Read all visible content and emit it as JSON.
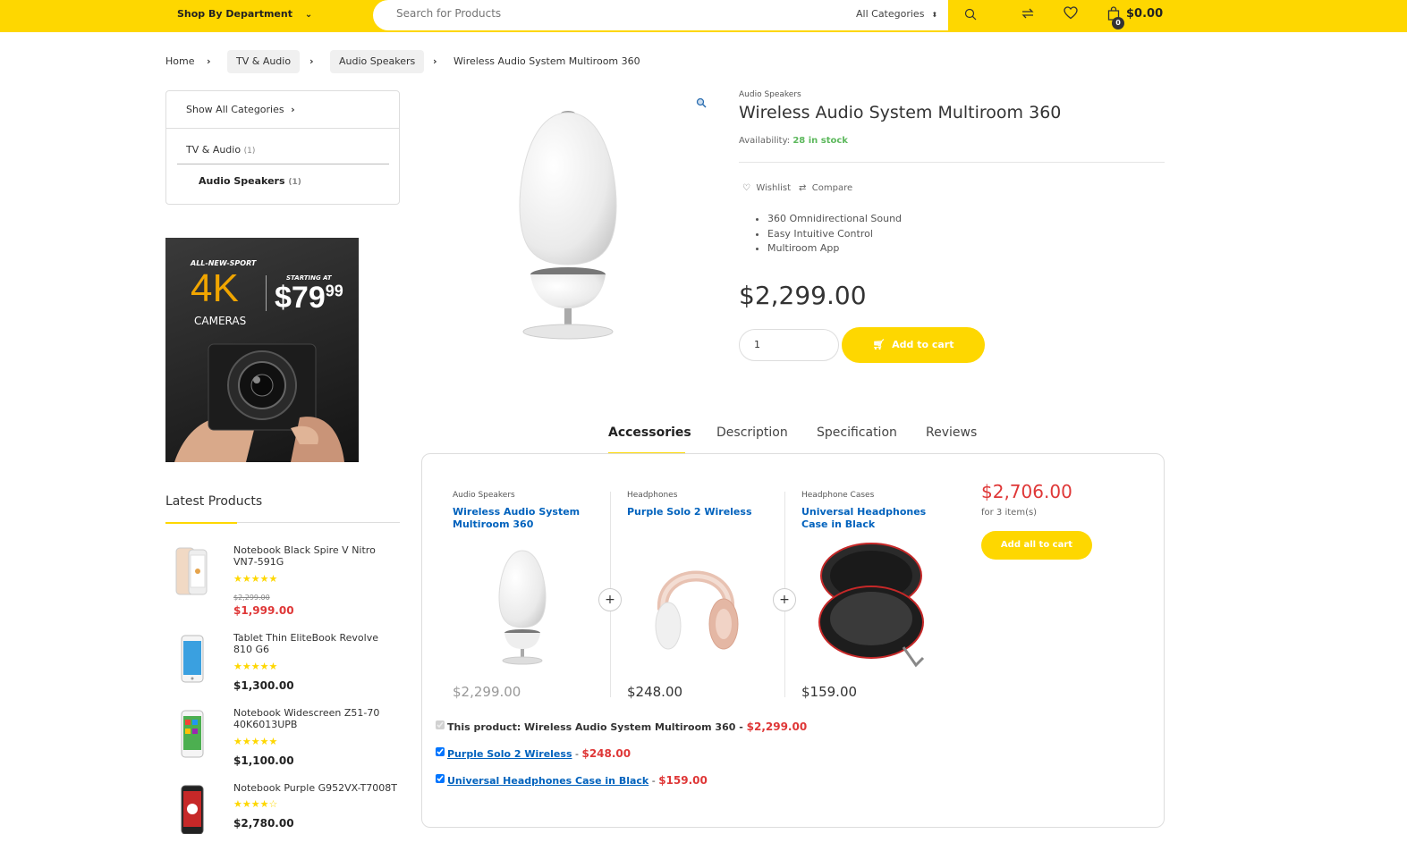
{
  "header": {
    "department_label": "Shop By Department",
    "search_placeholder": "Search for Products",
    "category_select": "All Categories",
    "cart_count": "0",
    "cart_total": "$0.00",
    "accent_color": "#fed700"
  },
  "breadcrumb": {
    "home": "Home",
    "level1": "TV & Audio",
    "level2": "Audio Speakers",
    "current": "Wireless Audio System Multiroom 360"
  },
  "sidebar": {
    "show_all": "Show All Categories",
    "tv_audio": "TV & Audio",
    "tv_audio_count": "(1)",
    "audio_speakers": "Audio Speakers",
    "audio_speakers_count": "(1)"
  },
  "banner": {
    "line1": "ALL-NEW-SPORT",
    "big": "4K",
    "line3": "CAMERAS",
    "starting": "STARTING AT",
    "price": "$79",
    "cents": "99"
  },
  "latest": {
    "title": "Latest Products",
    "items": [
      {
        "name": "Notebook Black Spire V Nitro VN7-591G",
        "stars": "★★★★★",
        "old_price": "$2,299.00",
        "price": "$1,999.00"
      },
      {
        "name": "Tablet Thin EliteBook Revolve 810 G6",
        "stars": "★★★★★",
        "price": "$1,300.00"
      },
      {
        "name": "Notebook Widescreen Z51-70 40K6013UPB",
        "stars": "★★★★★",
        "price": "$1,100.00"
      },
      {
        "name": "Notebook Purple G952VX-T7008T",
        "stars": "★★★★☆",
        "price": "$2,780.00"
      }
    ]
  },
  "product": {
    "category": "Audio Speakers",
    "title": "Wireless Audio System Multiroom 360",
    "availability_label": "Availability:",
    "availability_value": "28 in stock",
    "wishlist": "Wishlist",
    "compare": "Compare",
    "features": [
      "360 Omnidirectional Sound",
      "Easy Intuitive Control",
      "Multiroom App"
    ],
    "price": "$2,299.00",
    "qty": "1",
    "add_to_cart": "Add to cart"
  },
  "tabs": {
    "accessories": "Accessories",
    "description": "Description",
    "specification": "Specification",
    "reviews": "Reviews"
  },
  "accessories": {
    "items": [
      {
        "category": "Audio Speakers",
        "name": "Wireless Audio System Multiroom 360",
        "price": "$2,299.00"
      },
      {
        "category": "Headphones",
        "name": "Purple Solo 2 Wireless",
        "price": "$248.00"
      },
      {
        "category": "Headphone Cases",
        "name": "Universal Headphones Case in Black",
        "price": "$159.00"
      }
    ],
    "total": "$2,706.00",
    "total_sub": "for 3 item(s)",
    "add_all": "Add all to cart",
    "this_product_label": "This product: Wireless Audio System Multiroom 360",
    "this_product_price": "$2,299.00",
    "dash": " - "
  }
}
